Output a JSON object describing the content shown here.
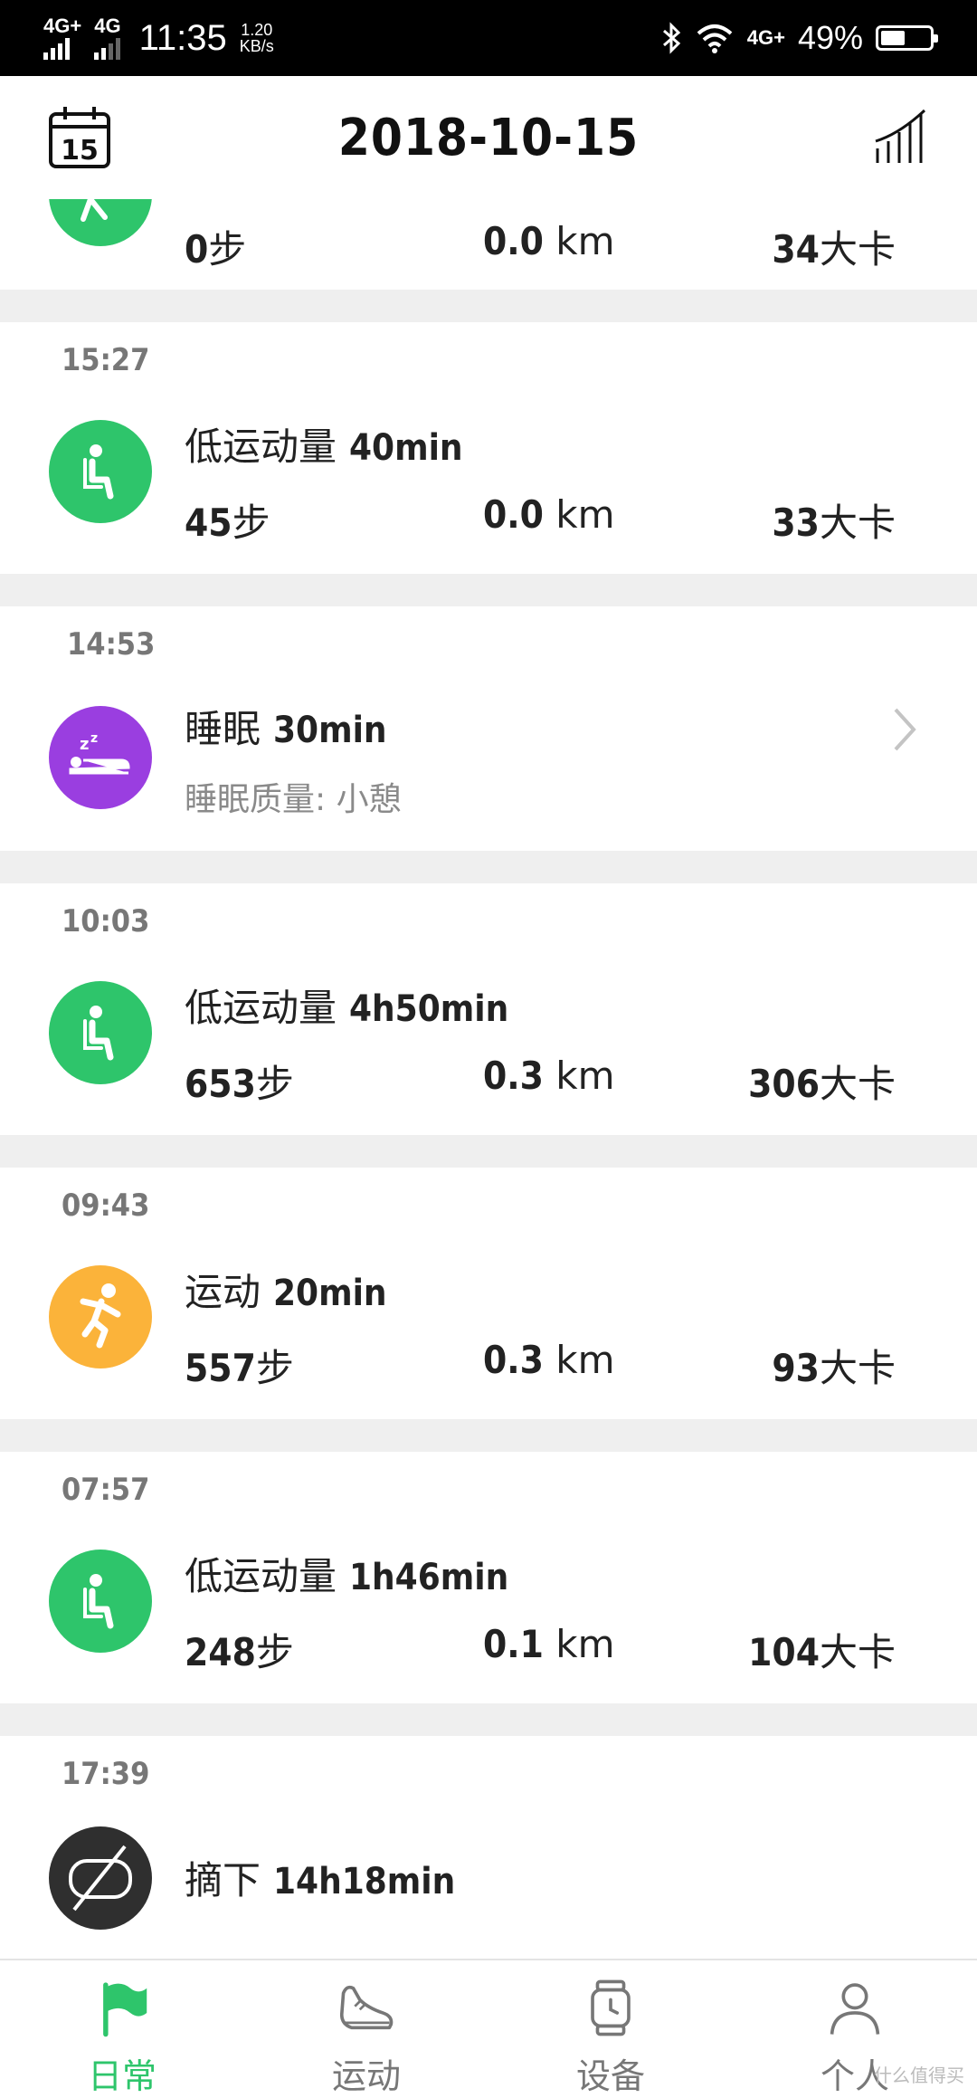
{
  "status_bar": {
    "net1": "4G+",
    "net2": "4G",
    "time": "11:35",
    "speed_value": "1.20",
    "speed_unit": "KB/s",
    "net3": "4G+",
    "battery": "49%"
  },
  "header": {
    "calendar_day": "15",
    "date": "2018-10-15"
  },
  "colors": {
    "green": "#2ec56b",
    "purple": "#9a3ee0",
    "orange": "#fbb33a",
    "dark": "#2f2f2f"
  },
  "activities": [
    {
      "type": "walk",
      "steps": "0",
      "steps_unit": "步",
      "distance": "0.0",
      "distance_unit": "km",
      "calories": "34",
      "calories_unit": "大卡"
    },
    {
      "time": "15:27",
      "type": "sedentary",
      "label": "低运动量",
      "duration": "40min",
      "steps": "45",
      "steps_unit": "步",
      "distance": "0.0",
      "distance_unit": "km",
      "calories": "33",
      "calories_unit": "大卡"
    },
    {
      "time": "14:53",
      "type": "sleep",
      "label": "睡眠",
      "duration": "30min",
      "subtitle": "睡眠质量: 小憩"
    },
    {
      "time": "10:03",
      "type": "sedentary",
      "label": "低运动量",
      "duration": "4h50min",
      "steps": "653",
      "steps_unit": "步",
      "distance": "0.3",
      "distance_unit": "km",
      "calories": "306",
      "calories_unit": "大卡"
    },
    {
      "time": "09:43",
      "type": "exercise",
      "label": "运动",
      "duration": "20min",
      "steps": "557",
      "steps_unit": "步",
      "distance": "0.3",
      "distance_unit": "km",
      "calories": "93",
      "calories_unit": "大卡"
    },
    {
      "time": "07:57",
      "type": "sedentary",
      "label": "低运动量",
      "duration": "1h46min",
      "steps": "248",
      "steps_unit": "步",
      "distance": "0.1",
      "distance_unit": "km",
      "calories": "104",
      "calories_unit": "大卡"
    },
    {
      "time": "17:39",
      "type": "off",
      "label": "摘下",
      "duration": "14h18min"
    }
  ],
  "tabs": [
    {
      "label": "日常",
      "icon": "flag-icon",
      "active": true
    },
    {
      "label": "运动",
      "icon": "shoe-icon",
      "active": false
    },
    {
      "label": "设备",
      "icon": "watch-icon",
      "active": false
    },
    {
      "label": "个人",
      "icon": "person-icon",
      "active": false
    }
  ],
  "watermark": "什么值得买"
}
